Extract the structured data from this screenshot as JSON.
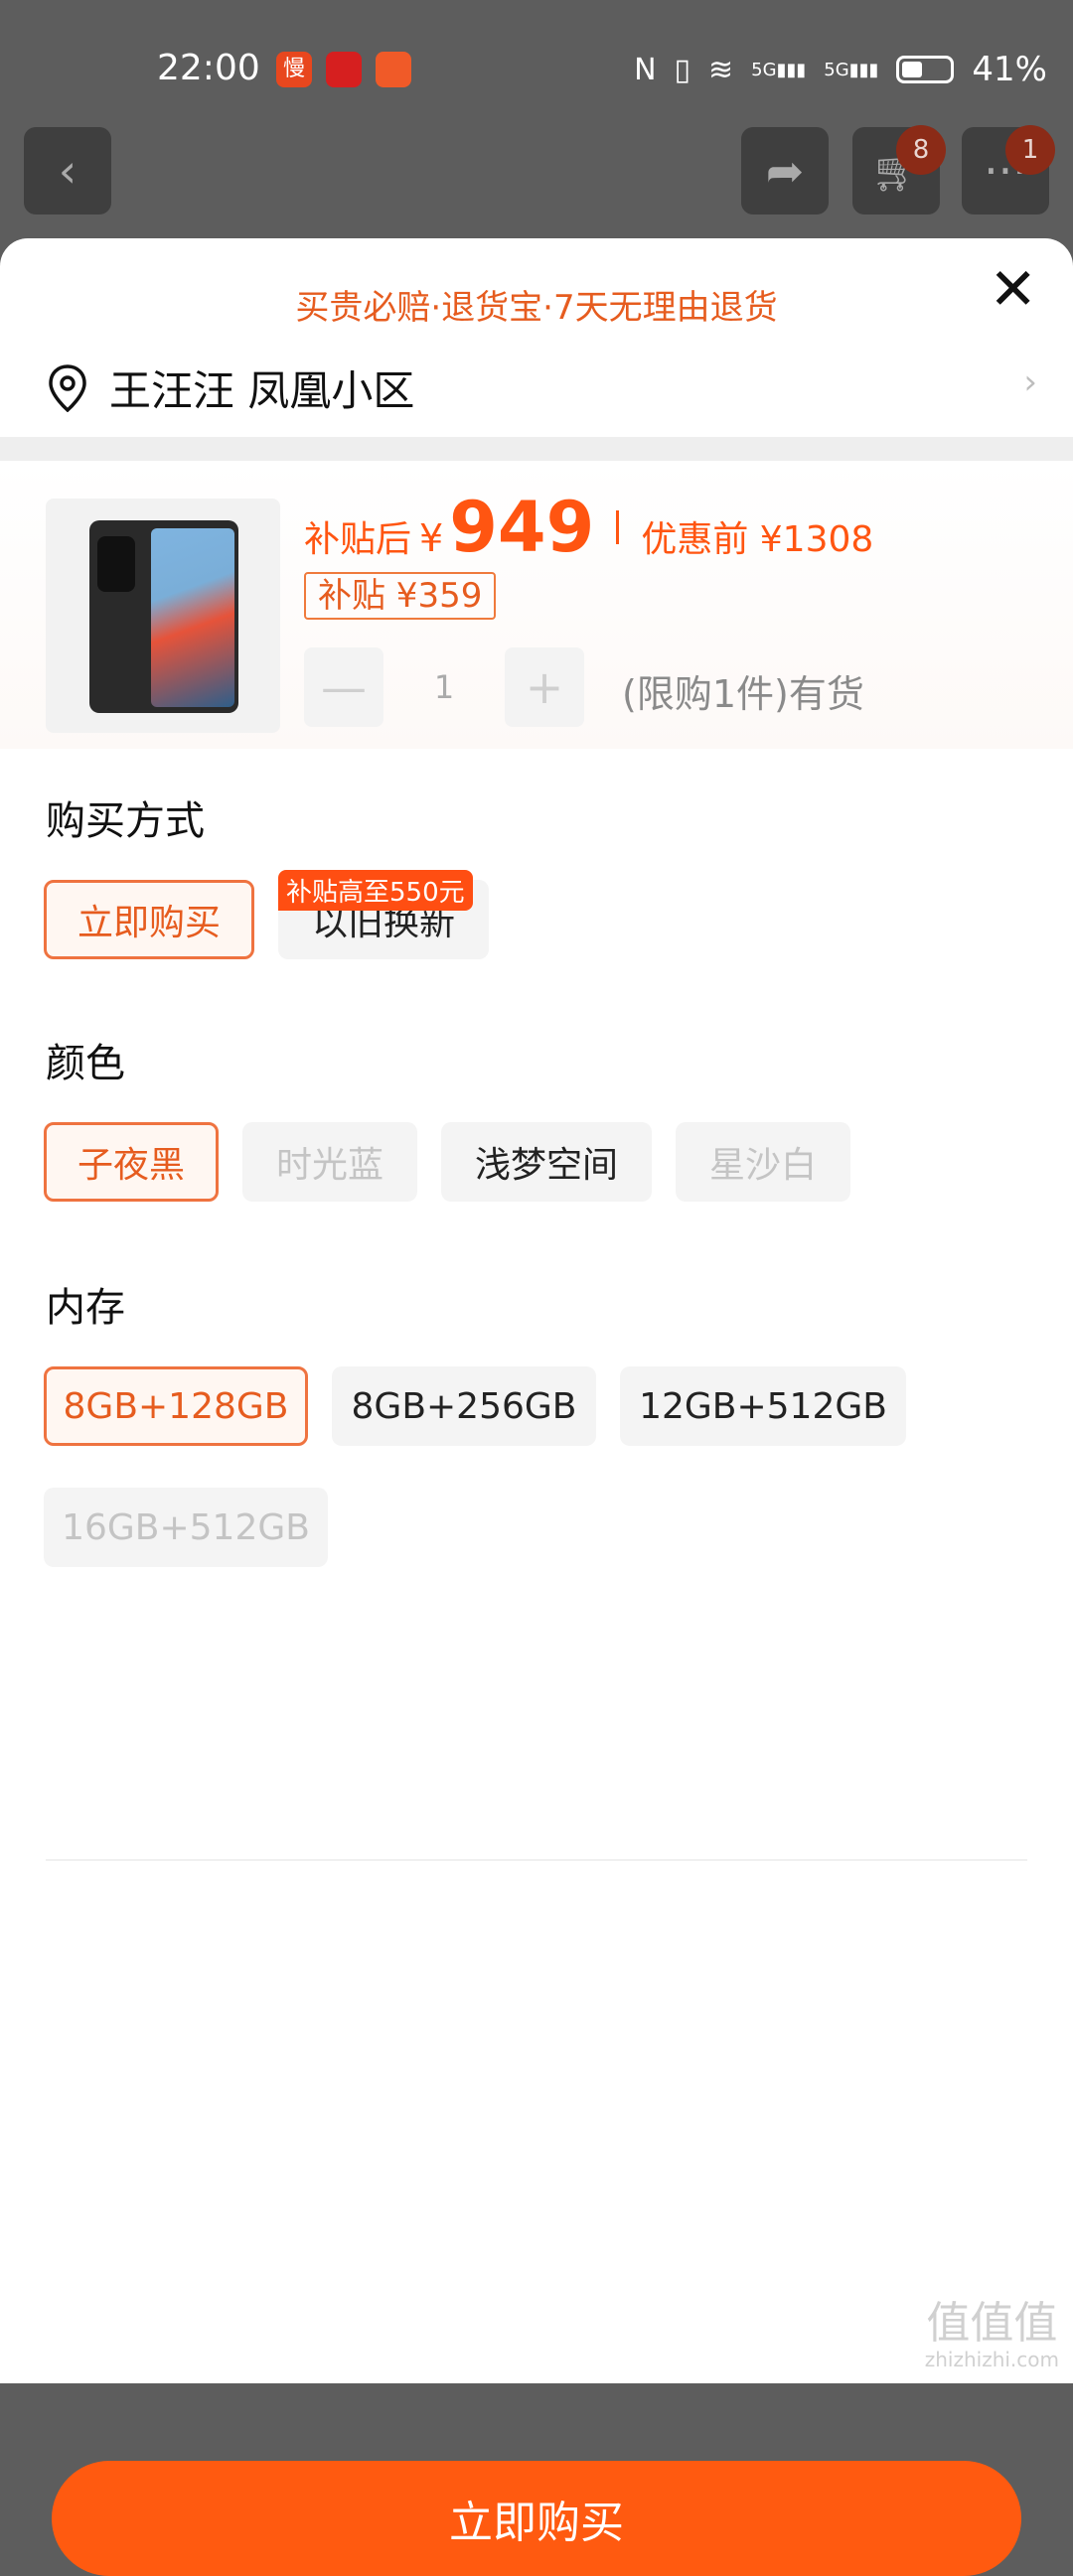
{
  "status_bar": {
    "time": "22:00",
    "app_icons": [
      "慢",
      "",
      ""
    ],
    "network_5g_1": "5G",
    "network_5g_2": "5G",
    "battery": "41%"
  },
  "top_nav": {
    "back_icon": "chevron-left-icon",
    "share_icon": "share-icon",
    "cart_badge": "8",
    "more_badge": "1"
  },
  "sheet": {
    "promo": "买贵必赔·退货宝·7天无理由退货",
    "address": "王汪汪 凤凰小区",
    "product": {
      "price_label": "补贴后",
      "currency": "¥",
      "price": "949",
      "original_label": "优惠前 ¥1308",
      "subsidy_tag": "补贴 ¥359",
      "quantity": "1",
      "minus": "—",
      "plus": "+",
      "stock_text": "(限购1件)有货"
    },
    "purchase_method": {
      "title": "购买方式",
      "options": [
        {
          "label": "立即购买",
          "state": "selected"
        },
        {
          "label": "以旧换新",
          "state": "normal",
          "badge": "补贴高至550元"
        }
      ]
    },
    "color": {
      "title": "颜色",
      "options": [
        {
          "label": "子夜黑",
          "state": "selected"
        },
        {
          "label": "时光蓝",
          "state": "disabled"
        },
        {
          "label": "浅梦空间",
          "state": "normal"
        },
        {
          "label": "星沙白",
          "state": "disabled"
        }
      ]
    },
    "memory": {
      "title": "内存",
      "options": [
        {
          "label": "8GB+128GB",
          "state": "selected"
        },
        {
          "label": "8GB+256GB",
          "state": "normal"
        },
        {
          "label": "12GB+512GB",
          "state": "normal"
        },
        {
          "label": "16GB+512GB",
          "state": "disabled"
        }
      ]
    },
    "buy_button": "立即购买"
  },
  "watermark": {
    "main": "值值值",
    "sub": "zhizhizhi.com"
  },
  "colors": {
    "accent": "#ff5a10",
    "accent_text": "#e65c1f"
  }
}
